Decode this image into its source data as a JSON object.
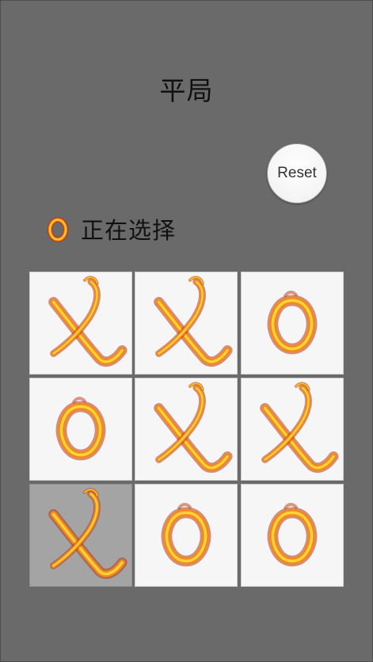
{
  "status_title": "平局",
  "reset_label": "Reset",
  "current_turn": {
    "mark": "O",
    "label": "正在选择"
  },
  "board": {
    "cells": [
      "X",
      "X",
      "O",
      "O",
      "X",
      "X",
      "X",
      "O",
      "O"
    ],
    "highlighted_index": 6
  },
  "colors": {
    "background": "#6a6a6a",
    "cell": "#f6f6f6",
    "cell_highlight": "#a4a4a4",
    "fire_inner": "#ffd23a",
    "fire_mid": "#f28a1b",
    "fire_outer": "#b8370f"
  }
}
